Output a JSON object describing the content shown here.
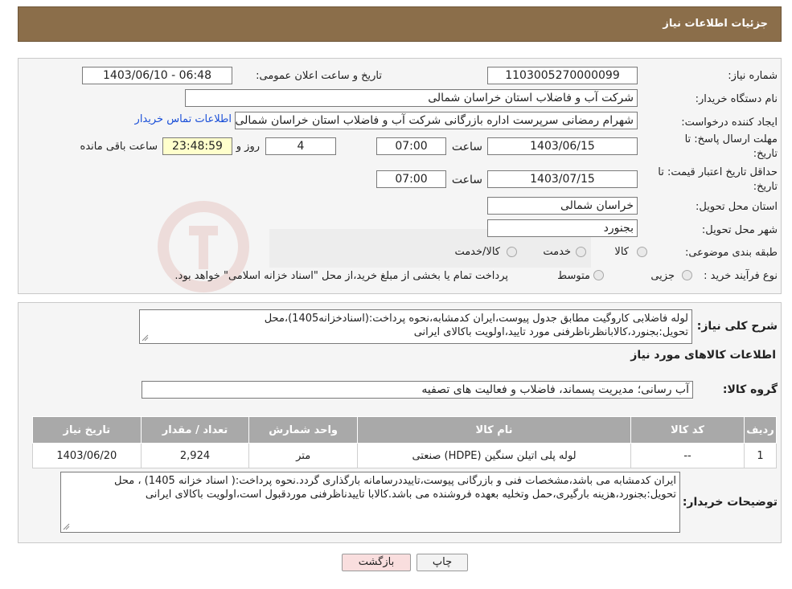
{
  "header": {
    "title": "جزئیات اطلاعات نیاز"
  },
  "form": {
    "need_number_label": "شماره نیاز:",
    "need_number": "1103005270000099",
    "announce_label": "تاریخ و ساعت اعلان عمومی:",
    "announce_value": "1403/06/10 - 06:48",
    "buyer_org_label": "نام دستگاه خریدار:",
    "buyer_org": "شرکت آب و فاضلاب استان خراسان شمالی",
    "creator_label": "ایجاد کننده درخواست:",
    "creator": "شهرام رمضانی سرپرست اداره بازرگانی  شرکت آب و فاضلاب استان خراسان شمالی",
    "contact_link": "اطلاعات تماس خریدار",
    "deadline_label_1": "مهلت ارسال پاسخ: تا",
    "deadline_label_2": "تاریخ:",
    "deadline_date": "1403/06/15",
    "time_label": "ساعت",
    "deadline_time": "07:00",
    "days_value": "4",
    "day_and_label": "روز و",
    "remaining_time": "23:48:59",
    "remaining_label": "ساعت باقی مانده",
    "validity_label_1": "حداقل تاریخ اعتبار قیمت: تا",
    "validity_label_2": "تاریخ:",
    "validity_date": "1403/07/15",
    "validity_time": "07:00",
    "province_label": "استان محل تحویل:",
    "province": "خراسان شمالی",
    "city_label": "شهر محل تحویل:",
    "city": "بجنورد",
    "category_label": "طبقه بندی موضوعی:",
    "category_options": [
      "کالا",
      "خدمت",
      "کالا/خدمت"
    ],
    "process_label": "نوع فرآیند خرید :",
    "process_options": [
      "جزیی",
      "متوسط"
    ],
    "process_note": "پرداخت تمام یا بخشی از مبلغ خرید،از محل \"اسناد خزانه اسلامی\" خواهد بود."
  },
  "details": {
    "summary_label": "شرح کلی نیاز:",
    "summary_text": "لوله فاضلابی کاروگیت مطابق جدول پیوست،ایران کدمشابه،نحوه پرداخت:(اسنادخزانه1405)،محل تحویل:بجنورد،کالابانظرناظرفنی مورد تایید،اولویت باکالای ایرانی",
    "goods_info_title": "اطلاعات کالاهای مورد نیاز",
    "goods_group_label": "گروه کالا:",
    "goods_group": "آب رسانی؛ مدیریت پسماند، فاضلاب و فعالیت های تصفیه",
    "table": {
      "headers": [
        "ردیف",
        "کد کالا",
        "نام کالا",
        "واحد شمارش",
        "تعداد / مقدار",
        "تاریخ نیاز"
      ],
      "rows": [
        {
          "row": "1",
          "code": "--",
          "name": "لوله پلی اتیلن سنگین (HDPE) صنعتی",
          "unit": "متر",
          "qty": "2,924",
          "date": "1403/06/20"
        }
      ]
    },
    "buyer_notes_label": "توضیحات خریدار:",
    "buyer_notes": "ایران کدمشابه می باشد،مشخصات فنی و بازرگانی پیوست،تاییددرسامانه بارگذاری گردد.نحوه پرداخت:( اسناد خزانه 1405) ، محل تحویل:بجنورد،هزینه بارگیری،حمل وتخلیه بعهده فروشنده می باشد.کالابا تاییدناظرفنی موردقبول است،اولویت باکالای ایرانی"
  },
  "buttons": {
    "print": "چاپ",
    "back": "بازگشت"
  },
  "colors": {
    "header_bg": "#8b6e4a",
    "table_header_bg": "#a9a9a9",
    "remaining_bg": "#ffffcc",
    "back_btn_bg": "#f9dede",
    "link": "#1a4fd8"
  }
}
